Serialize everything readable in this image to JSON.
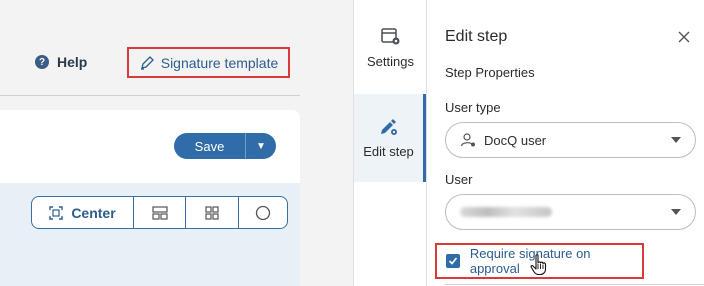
{
  "header": {
    "help_label": "Help",
    "help_icon": "question-circle-icon",
    "signature_template_label": "Signature template",
    "signature_icon": "pen-icon"
  },
  "toolbar": {
    "save_label": "Save",
    "save_dropdown_icon": "caret-down-icon"
  },
  "alignment": {
    "center_label": "Center",
    "options": [
      "center",
      "layout-rows",
      "grid",
      "circle"
    ]
  },
  "side_tabs": [
    {
      "label": "Settings",
      "icon": "settings-doc-icon",
      "active": false
    },
    {
      "label": "Edit step",
      "icon": "edit-step-icon",
      "active": true
    }
  ],
  "edit_panel": {
    "title": "Edit step",
    "section_heading": "Step Properties",
    "user_type_label": "User type",
    "user_type_value": "DocQ user",
    "user_label": "User",
    "user_value": "",
    "require_signature_label": "Require signature on approval",
    "require_signature_checked": true
  },
  "colors": {
    "accent": "#2f6ca8",
    "highlight_border": "#d83a3a"
  }
}
